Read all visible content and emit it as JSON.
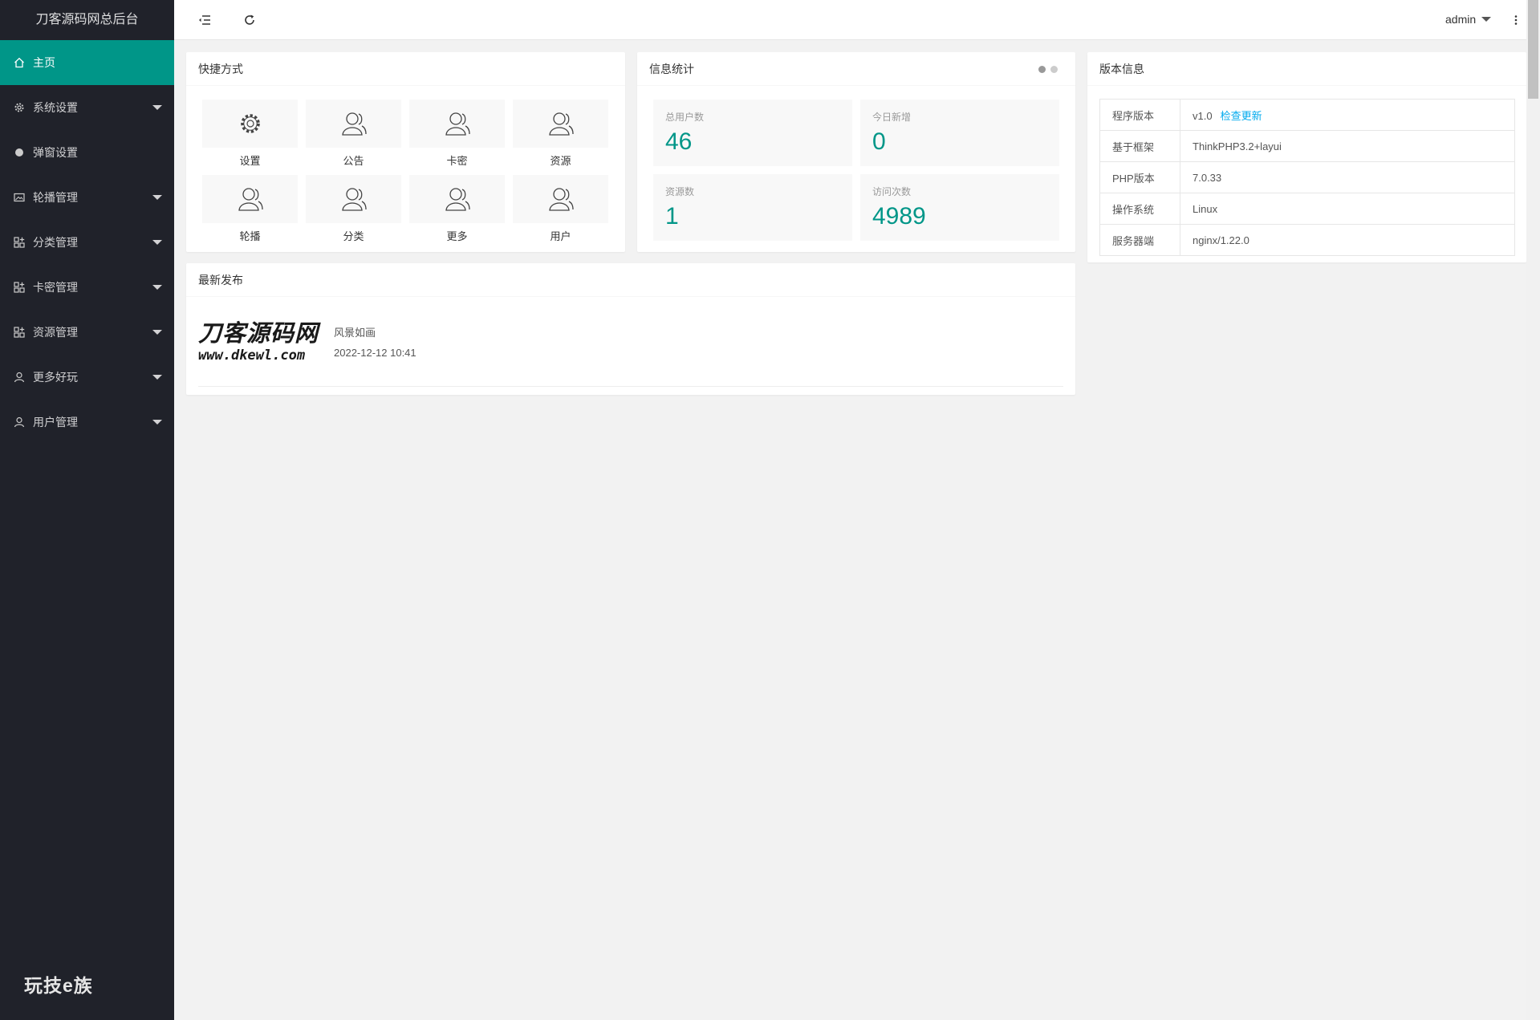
{
  "sidebar": {
    "logo": "刀客源码网总后台",
    "items": [
      {
        "label": "主页",
        "icon": "home-icon"
      },
      {
        "label": "系统设置",
        "icon": "gear-icon"
      },
      {
        "label": "弹窗设置",
        "icon": "circle-icon"
      },
      {
        "label": "轮播管理",
        "icon": "image-icon"
      },
      {
        "label": "分类管理",
        "icon": "apps-icon"
      },
      {
        "label": "卡密管理",
        "icon": "apps-icon"
      },
      {
        "label": "资源管理",
        "icon": "apps-icon"
      },
      {
        "label": "更多好玩",
        "icon": "user-icon"
      },
      {
        "label": "用户管理",
        "icon": "user-icon"
      }
    ],
    "brand": "玩技e族"
  },
  "header": {
    "user": "admin"
  },
  "shortcuts": {
    "title": "快捷方式",
    "items": [
      {
        "label": "设置",
        "icon": "gear-icon"
      },
      {
        "label": "公告",
        "icon": "user-icon"
      },
      {
        "label": "卡密",
        "icon": "user-icon"
      },
      {
        "label": "资源",
        "icon": "user-icon"
      },
      {
        "label": "轮播",
        "icon": "user-icon"
      },
      {
        "label": "分类",
        "icon": "user-icon"
      },
      {
        "label": "更多",
        "icon": "user-icon"
      },
      {
        "label": "用户",
        "icon": "user-icon"
      }
    ]
  },
  "stats": {
    "title": "信息统计",
    "items": [
      {
        "label": "总用户数",
        "value": "46"
      },
      {
        "label": "今日新增",
        "value": "0"
      },
      {
        "label": "资源数",
        "value": "1"
      },
      {
        "label": "访问次数",
        "value": "4989"
      }
    ]
  },
  "version": {
    "title": "版本信息",
    "rows": [
      {
        "key": "程序版本",
        "value": "v1.0",
        "link": "检查更新"
      },
      {
        "key": "基于框架",
        "value": "ThinkPHP3.2+layui"
      },
      {
        "key": "PHP版本",
        "value": "7.0.33"
      },
      {
        "key": "操作系统",
        "value": "Linux"
      },
      {
        "key": "服务器端",
        "value": "nginx/1.22.0"
      }
    ]
  },
  "latest": {
    "title": "最新发布",
    "thumb_line1": "刀客源码网",
    "thumb_line2": "www.dkewl.com",
    "post_title": "风景如画",
    "post_date": "2022-12-12 10:41"
  },
  "colors": {
    "accent": "#009688",
    "sidebar": "#20222a",
    "link": "#01aaed"
  }
}
